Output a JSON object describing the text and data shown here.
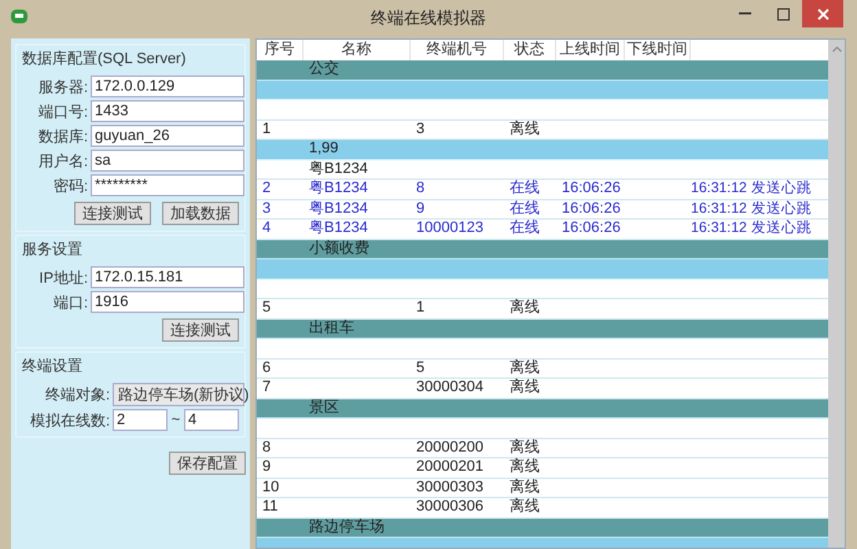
{
  "window": {
    "title": "终端在线模拟器"
  },
  "database": {
    "title": "数据库配置(SQL Server)",
    "fields": [
      {
        "label": "服务器:",
        "value": "172.0.0.129"
      },
      {
        "label": "端口号:",
        "value": "1433"
      },
      {
        "label": "数据库:",
        "value": "guyuan_26"
      },
      {
        "label": "用户名:",
        "value": "sa"
      },
      {
        "label": "密码:",
        "value": "*********"
      }
    ],
    "buttons": [
      "连接测试",
      "加载数据"
    ]
  },
  "service": {
    "title": "服务设置",
    "fields": [
      {
        "label": "IP地址:",
        "value": "172.0.15.181"
      },
      {
        "label": "端口:",
        "value": "1916"
      }
    ],
    "buttons": [
      "连接测试"
    ]
  },
  "terminal": {
    "title": "终端设置",
    "target": {
      "label": "终端对象:",
      "value": "路边停车场(新协议)"
    },
    "range": {
      "label": "模拟在线数:",
      "from": "2",
      "separator": "~",
      "to": "4"
    }
  },
  "save_button": "保存配置",
  "table": {
    "columns": [
      "序号",
      "名称",
      "终端机号",
      "状态",
      "上线时间",
      "下线时间"
    ],
    "rows": [
      {
        "kind": "group",
        "name": "公交"
      },
      {
        "kind": "band"
      },
      {
        "kind": "row"
      },
      {
        "kind": "row",
        "seq": "1",
        "terminal": "3",
        "status": "离线",
        "online": false
      },
      {
        "kind": "band",
        "name": "1,99"
      },
      {
        "kind": "row",
        "name": "粤B1234"
      },
      {
        "kind": "row",
        "seq": "2",
        "name": "粤B1234",
        "terminal": "8",
        "status": "在线",
        "online_time": "16:06:26",
        "column_7": "16:31:12 发送心跳",
        "online": true
      },
      {
        "kind": "row",
        "seq": "3",
        "name": "粤B1234",
        "terminal": "9",
        "status": "在线",
        "online_time": "16:06:26",
        "column_7": "16:31:12 发送心跳",
        "online": true
      },
      {
        "kind": "row",
        "seq": "4",
        "name": "粤B1234",
        "terminal": "10000123",
        "status": "在线",
        "online_time": "16:06:26",
        "column_7": "16:31:12 发送心跳",
        "online": true
      },
      {
        "kind": "group",
        "name": "小额收费"
      },
      {
        "kind": "band"
      },
      {
        "kind": "row"
      },
      {
        "kind": "row",
        "seq": "5",
        "terminal": "1",
        "status": "离线",
        "online": false
      },
      {
        "kind": "group",
        "name": "出租车"
      },
      {
        "kind": "row"
      },
      {
        "kind": "row",
        "seq": "6",
        "terminal": "5",
        "status": "离线",
        "online": false
      },
      {
        "kind": "row",
        "seq": "7",
        "terminal": "30000304",
        "status": "离线",
        "online": false
      },
      {
        "kind": "group",
        "name": "景区"
      },
      {
        "kind": "row"
      },
      {
        "kind": "row",
        "seq": "8",
        "terminal": "20000200",
        "status": "离线",
        "online": false
      },
      {
        "kind": "row",
        "seq": "9",
        "terminal": "20000201",
        "status": "离线",
        "online": false
      },
      {
        "kind": "row",
        "seq": "10",
        "terminal": "30000303",
        "status": "离线",
        "online": false
      },
      {
        "kind": "row",
        "seq": "11",
        "terminal": "30000306",
        "status": "离线",
        "online": false
      },
      {
        "kind": "group",
        "name": "路边停车场"
      },
      {
        "kind": "band"
      }
    ]
  }
}
